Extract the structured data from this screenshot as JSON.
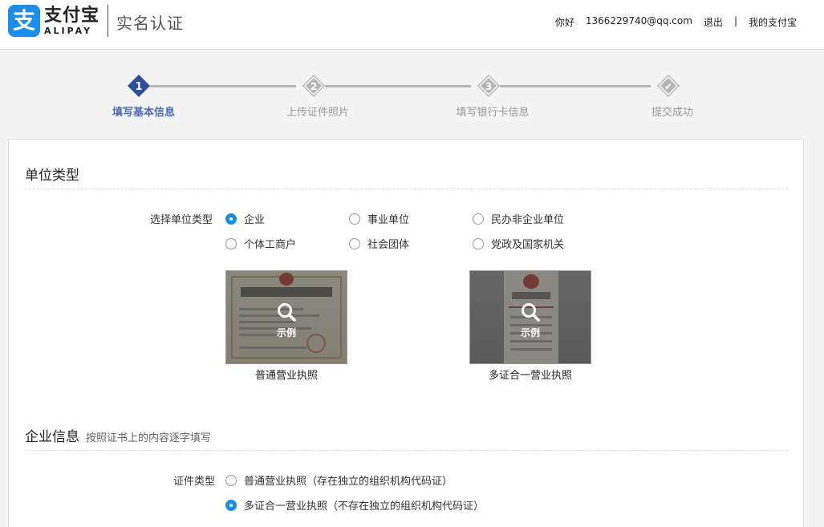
{
  "header": {
    "logo_glyph": "支",
    "logo_cn": "支付宝",
    "logo_en": "ALIPAY",
    "page_heading": "实名认证",
    "greeting": "你好",
    "account": "1366229740@qq.com",
    "logout": "退出",
    "separator": "|",
    "my_alipay": "我的支付宝"
  },
  "steps": [
    {
      "number": "1",
      "label": "填写基本信息",
      "state": "active"
    },
    {
      "number": "2",
      "label": "上传证件照片",
      "state": "pending"
    },
    {
      "number": "3",
      "label": "填写银行卡信息",
      "state": "pending"
    },
    {
      "number": "✔",
      "label": "提交成功",
      "state": "pending"
    }
  ],
  "unit_type": {
    "title": "单位类型",
    "field_label": "选择单位类型",
    "options": [
      {
        "label": "企业",
        "checked": true
      },
      {
        "label": "事业单位",
        "checked": false
      },
      {
        "label": "民办非企业单位",
        "checked": false
      },
      {
        "label": "个体工商户",
        "checked": false
      },
      {
        "label": "社会团体",
        "checked": false
      },
      {
        "label": "党政及国家机关",
        "checked": false
      }
    ],
    "samples": [
      {
        "zoom_label": "示例",
        "caption": "普通营业执照"
      },
      {
        "zoom_label": "示例",
        "caption": "多证合一营业执照"
      }
    ]
  },
  "company_info": {
    "title": "企业信息",
    "subtitle": "按照证书上的内容逐字填写",
    "field_label": "证件类型",
    "options": [
      {
        "label": "普通营业执照（存在独立的组织机构代码证）",
        "checked": false
      },
      {
        "label": "多证合一营业执照（不存在独立的组织机构代码证）",
        "checked": true
      }
    ]
  },
  "colors": {
    "brand_blue": "#1d8ee8",
    "step_active": "#4d6bb4",
    "step_pending": "#b5b5b5"
  }
}
